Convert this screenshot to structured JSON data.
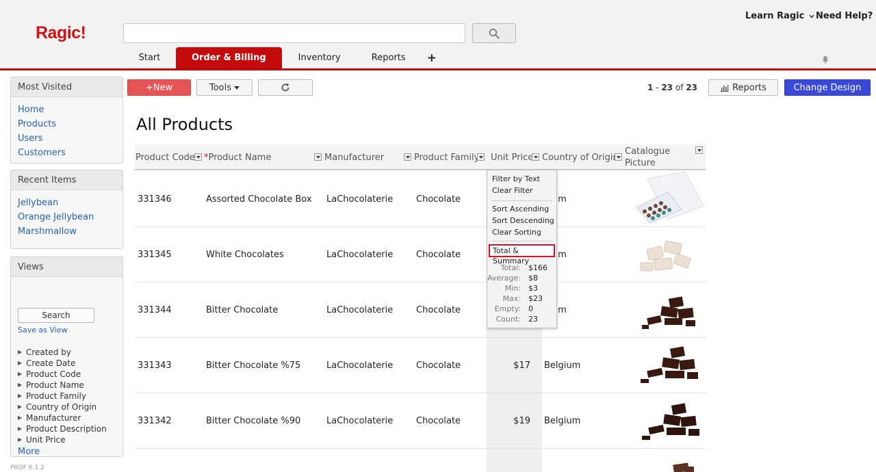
{
  "header": {
    "logo": "Ragic!",
    "learn_ragic": "Learn Ragic",
    "need_help": "Need Help?",
    "search_placeholder": "",
    "tabs": [
      {
        "label": "Start"
      },
      {
        "label": "Order & Billing",
        "active": true
      },
      {
        "label": "Inventory"
      },
      {
        "label": "Reports"
      },
      {
        "label": "+"
      }
    ]
  },
  "sidebar": {
    "most_visited": {
      "title": "Most Visited",
      "links": [
        "Home",
        "Products",
        "Users",
        "Customers"
      ]
    },
    "recent_items": {
      "title": "Recent Items",
      "links": [
        "Jellybean",
        "Orange Jellybean",
        "Marshmallow"
      ]
    },
    "views": {
      "title": "Views",
      "search_label": "Search",
      "save_as_view": "Save as View",
      "fields": [
        "Created by",
        "Create Date",
        "Product Code",
        "Product Name",
        "Product Family",
        "Country of Origin",
        "Manufacturer",
        "Product Description",
        "Unit Price"
      ],
      "more": "More"
    },
    "version": "PROF 6.1.2"
  },
  "toolbar": {
    "new_label": "+New",
    "tools_label": "Tools",
    "pager": {
      "start": "1",
      "end": "23",
      "of": "of",
      "total": "23"
    },
    "reports_label": "Reports",
    "change_design_label": "Change Design"
  },
  "page": {
    "title": "All Products"
  },
  "table": {
    "columns": [
      "Product Code",
      "Product Name",
      "Manufacturer",
      "Product Family",
      "Unit Price",
      "Country of Origin",
      "Catalogue Picture"
    ],
    "rows": [
      {
        "code": "331346",
        "name": "Assorted Chocolate Box",
        "manufacturer": "LaChocolaterie",
        "family": "Chocolate",
        "price": "",
        "country": "gium"
      },
      {
        "code": "331345",
        "name": "White Chocolates",
        "manufacturer": "LaChocolaterie",
        "family": "Chocolate",
        "price": "",
        "country": "gium"
      },
      {
        "code": "331344",
        "name": "Bitter Chocolate",
        "manufacturer": "LaChocolaterie",
        "family": "Chocolate",
        "price": "",
        "country": "gium"
      },
      {
        "code": "331343",
        "name": "Bitter Chocolate %75",
        "manufacturer": "LaChocolaterie",
        "family": "Chocolate",
        "price": "$17",
        "country": "Belgium"
      },
      {
        "code": "331342",
        "name": "Bitter Chocolate %90",
        "manufacturer": "LaChocolaterie",
        "family": "Chocolate",
        "price": "$19",
        "country": "Belgium"
      }
    ]
  },
  "column_menu": {
    "filter_by_text": "Filter by Text",
    "clear_filter": "Clear Filter",
    "sort_ascending": "Sort Ascending",
    "sort_descending": "Sort Descending",
    "clear_sorting": "Clear Sorting",
    "total_summary": "Total & Summary",
    "summary": [
      {
        "label": "Total:",
        "value": "$166"
      },
      {
        "label": "Average:",
        "value": "$8"
      },
      {
        "label": "Min:",
        "value": "$3"
      },
      {
        "label": "Max:",
        "value": "$23"
      },
      {
        "label": "Empty:",
        "value": "0"
      },
      {
        "label": "Count:",
        "value": "23"
      }
    ]
  },
  "colors": {
    "brand_red": "#c30b0b",
    "accent_blue": "#3b4ad6",
    "link_blue": "#2460b8"
  }
}
